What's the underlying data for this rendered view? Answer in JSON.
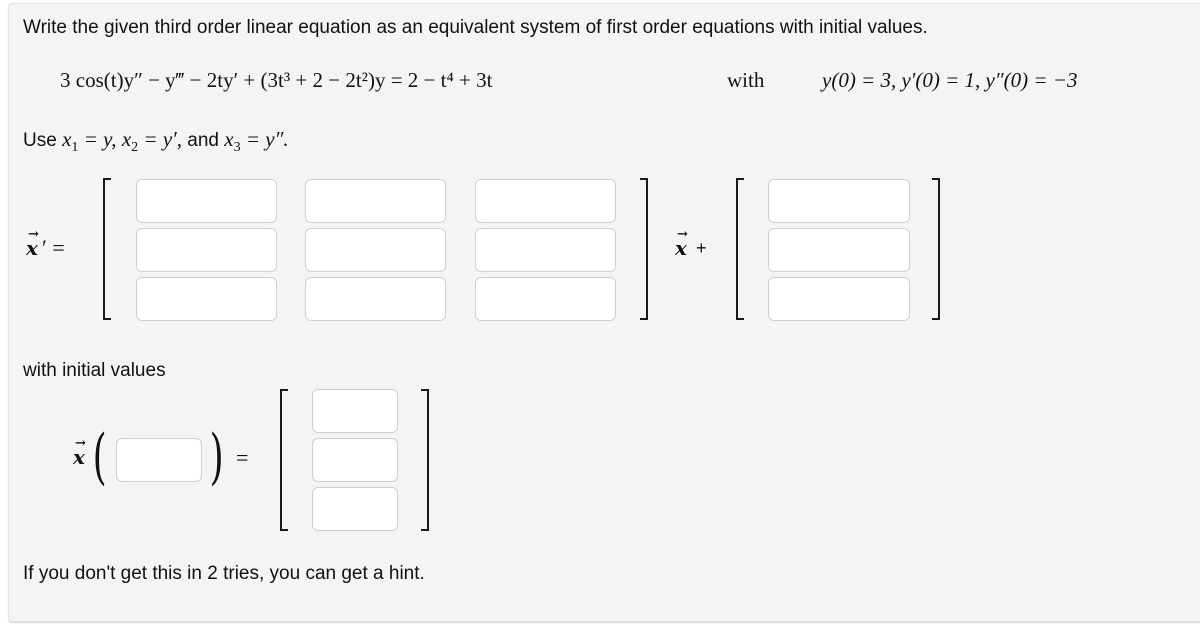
{
  "prompt": "Write the given third order linear equation as an equivalent system of first order equations with initial values.",
  "equation": {
    "lhs_rhs": "3 cos(t)y″ − y‴ − 2ty′ + (3t³ + 2 − 2t²)y = 2 − t⁴ + 3t",
    "with_label": "with",
    "initial_conditions": "y(0) = 3,  y′(0) = 1,  y″(0) = −3"
  },
  "substitution": {
    "use_label": "Use",
    "x1": "x",
    "x1_sub": "1",
    "x1_eq": "= y,",
    "x2": "x",
    "x2_sub": "2",
    "x2_eq": "= y′,",
    "and_label": "and",
    "x3": "x",
    "x3_sub": "3",
    "x3_eq": "= y″."
  },
  "system": {
    "lhs_var": "x",
    "lhs_prime": "′ =",
    "plus_label": "+",
    "matrix_inputs": [
      [
        "",
        "",
        ""
      ],
      [
        "",
        "",
        ""
      ],
      [
        "",
        "",
        ""
      ]
    ],
    "vector_inputs": [
      "",
      "",
      ""
    ]
  },
  "initial_values": {
    "label": "with initial values",
    "vector_var": "x",
    "time_input": "",
    "equals_label": "=",
    "vector_inputs": [
      "",
      "",
      ""
    ]
  },
  "hint_text": "If you don't get this in 2 tries, you can get a hint."
}
